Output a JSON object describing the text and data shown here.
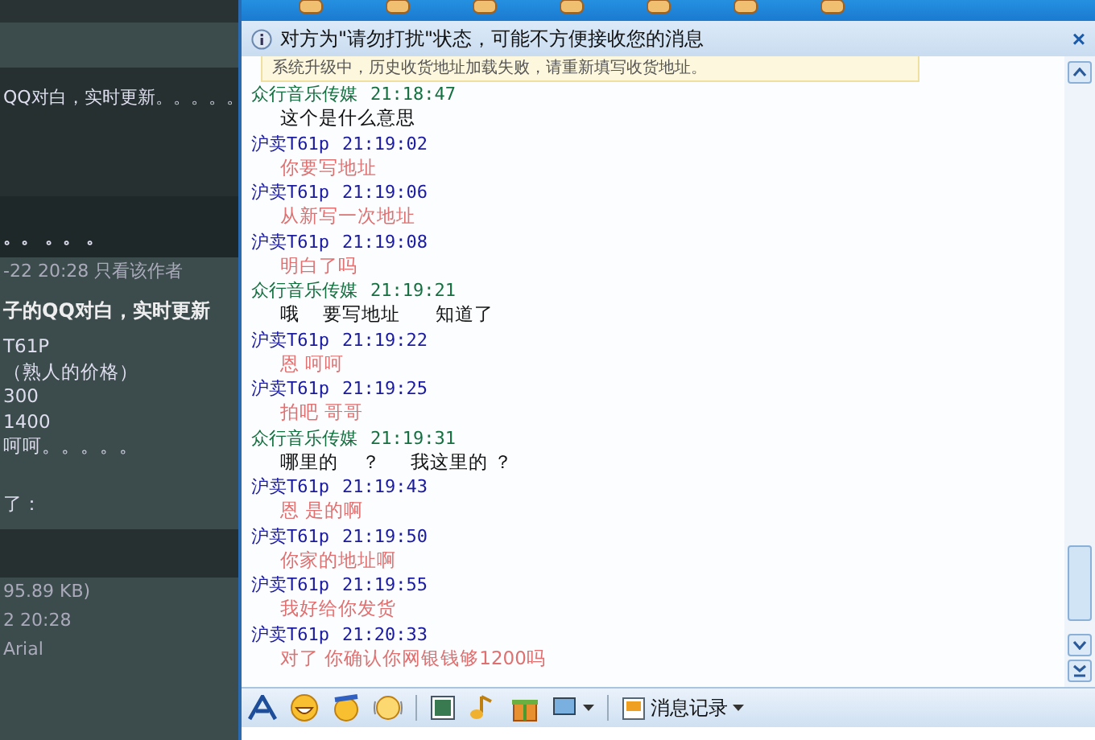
{
  "forum": {
    "lines": [
      {
        "kind": "title",
        "text": "QQ对白，实时更新。。。。。"
      },
      {
        "kind": "dots",
        "text": "。。 。。 。"
      },
      {
        "kind": "meta",
        "text": "-22 20:28 只看该作者"
      },
      {
        "kind": "heading",
        "text": "子的QQ对白，实时更新"
      },
      {
        "kind": "body",
        "text": "T61P"
      },
      {
        "kind": "body",
        "text": "（熟人的价格）"
      },
      {
        "kind": "body",
        "text": "300"
      },
      {
        "kind": "body",
        "text": "1400"
      },
      {
        "kind": "body",
        "text": "呵呵。。。。。"
      },
      {
        "kind": "gap"
      },
      {
        "kind": "body",
        "text": "了："
      },
      {
        "kind": "band"
      },
      {
        "kind": "meta",
        "text": "95.89 KB)"
      },
      {
        "kind": "meta",
        "text": "2 20:28"
      },
      {
        "kind": "meta",
        "text": "Arial"
      }
    ]
  },
  "chat": {
    "notice": "对方为\"请勿打扰\"状态，可能不方便接收您的消息",
    "close": "×",
    "tip": "系统升级中，历史收货地址加载失败，请重新填写收货地址。",
    "messages": [
      {
        "sender": "众行音乐传媒",
        "time": "21:18:47",
        "text": "这个是什么意思",
        "kind": "other"
      },
      {
        "sender": "沪卖T61p",
        "time": "21:19:02",
        "text": "你要写地址",
        "kind": "self"
      },
      {
        "sender": "沪卖T61p",
        "time": "21:19:06",
        "text": "从新写一次地址",
        "kind": "self"
      },
      {
        "sender": "沪卖T61p",
        "time": "21:19:08",
        "text": "明白了吗",
        "kind": "self"
      },
      {
        "sender": "众行音乐传媒",
        "time": "21:19:21",
        "text": "哦    要写地址      知道了",
        "kind": "other"
      },
      {
        "sender": "沪卖T61p",
        "time": "21:19:22",
        "text": "恩 呵呵",
        "kind": "self"
      },
      {
        "sender": "沪卖T61p",
        "time": "21:19:25",
        "text": "拍吧 哥哥",
        "kind": "self"
      },
      {
        "sender": "众行音乐传媒",
        "time": "21:19:31",
        "text": "哪里的    ？     我这里的 ？",
        "kind": "other"
      },
      {
        "sender": "沪卖T61p",
        "time": "21:19:43",
        "text": "恩 是的啊",
        "kind": "self"
      },
      {
        "sender": "沪卖T61p",
        "time": "21:19:50",
        "text": "你家的地址啊",
        "kind": "self"
      },
      {
        "sender": "沪卖T61p",
        "time": "21:19:55",
        "text": "我好给你发货",
        "kind": "self"
      },
      {
        "sender": "沪卖T61p",
        "time": "21:20:33",
        "text": "对了 你确认你网银钱够1200吗",
        "kind": "self"
      }
    ],
    "history": "消息记录"
  }
}
